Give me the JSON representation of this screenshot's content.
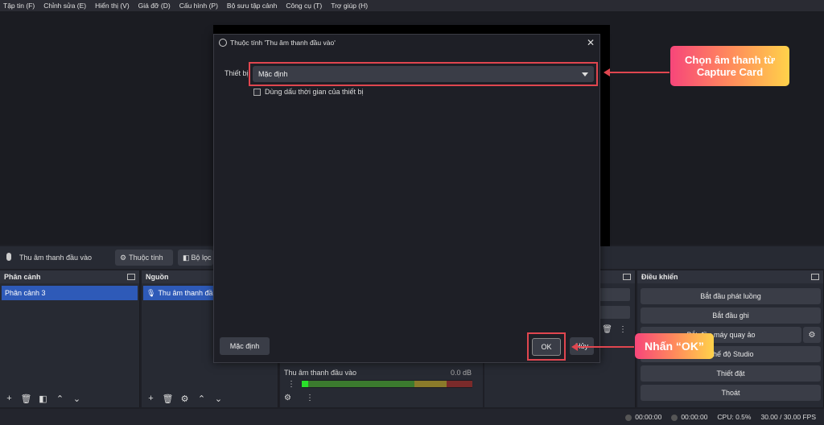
{
  "menu": [
    "Tập tin (F)",
    "Chỉnh sửa (E)",
    "Hiển thị (V)",
    "Giá đỡ (D)",
    "Cấu hình (P)",
    "Bộ sưu tập cảnh",
    "Công cụ (T)",
    "Trợ giúp (H)"
  ],
  "context_bar": {
    "source_name": "Thu âm thanh đầu vào",
    "properties_btn": "Thuộc tính",
    "filters_btn": "Bộ lọc"
  },
  "scenes": {
    "title": "Phân cảnh",
    "items": [
      "Phân cảnh 3"
    ]
  },
  "sources": {
    "title": "Nguồn",
    "items": [
      "Thu âm thanh đầu vào"
    ]
  },
  "mixer": {
    "track_name": "Thu âm thanh đầu vào",
    "db": "0.0 dB"
  },
  "controls": {
    "title": "Điều khiển",
    "buttons": [
      "Bắt đầu phát luồng",
      "Bắt đầu ghi",
      "Bắt đầu máy quay ảo",
      "Chế độ Studio",
      "Thiết đặt",
      "Thoát"
    ]
  },
  "status": {
    "rec_time": "00:00:00",
    "stream_time": "00:00:00",
    "cpu": "CPU: 0.5%",
    "fps": "30.00 / 30.00 FPS"
  },
  "dialog": {
    "title": "Thuộc tính 'Thu âm thanh đầu vào'",
    "device_label": "Thiết bị",
    "device_value": "Mặc định",
    "checkbox_label": "Dùng dấu thời gian của thiết bị",
    "default_btn": "Mặc định",
    "ok_btn": "OK",
    "cancel_btn": "Hủy"
  },
  "annotations": {
    "callout1": "Chọn âm thanh từ Capture Card",
    "callout2": "Nhấn “OK”"
  },
  "colors": {
    "accent": "#e0464f",
    "selected": "#2e5ab8"
  }
}
